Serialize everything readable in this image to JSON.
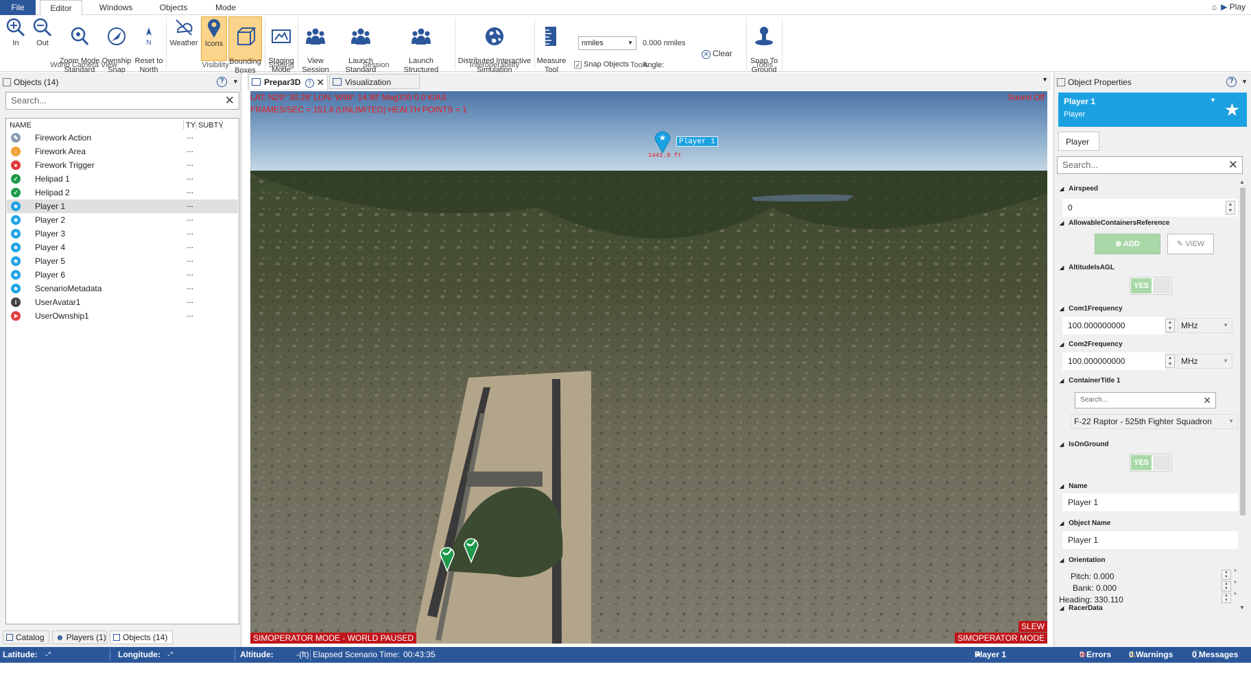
{
  "menu": {
    "items": [
      "File",
      "Editor",
      "Windows",
      "Objects",
      "Mode"
    ],
    "right_label": "Play"
  },
  "ribbon": {
    "buttons": [
      {
        "label": "In",
        "icon": "zoom-in-icon"
      },
      {
        "label": "Out",
        "icon": "zoom-out-icon"
      },
      {
        "label": "Zoom Mode\nStandard",
        "icon": "zoom-mode-icon"
      },
      {
        "label": "Ownship\nSnap",
        "icon": "ownship-snap-icon"
      },
      {
        "label": "Reset to\nNorth",
        "icon": "north-arrow-icon"
      },
      {
        "label": "Weather",
        "icon": "weather-icon"
      },
      {
        "label": "Icons",
        "icon": "map-pin-icon"
      },
      {
        "label": "Bounding\nBoxes",
        "icon": "bounding-box-icon"
      },
      {
        "label": "Staging\nMode",
        "icon": "staging-icon"
      },
      {
        "label": "View\nSession",
        "icon": "group-icon"
      },
      {
        "label": "Launch Standard\nScenario",
        "icon": "group-icon"
      },
      {
        "label": "Launch Structured\nScenario",
        "icon": "group-icon"
      },
      {
        "label": "Distributed Interactive\nSimulation",
        "icon": "globe-icon"
      },
      {
        "label": "Measure\nTool",
        "icon": "ruler-icon"
      },
      {
        "label": "Snap To\nGround",
        "icon": "snap-ground-icon"
      }
    ],
    "groups": [
      "World Camera View",
      "Visibility",
      "Staging",
      "Session",
      "Interoperability",
      "Tools",
      "Tools"
    ],
    "unit_select": "nmiles",
    "distance": "0.000 nmiles",
    "snap_objects": "Snap Objects",
    "angle": "Angle:",
    "clear": "Clear",
    "colors": {
      "selected": "#fbd38a",
      "accent": "#2b579a"
    }
  },
  "objects_panel": {
    "title": "Objects (14)",
    "search_placeholder": "Search...",
    "columns": [
      "NAME",
      "TY",
      "SUBTY"
    ],
    "rows": [
      {
        "name": "Firework Action",
        "type": "...",
        "icon": "wrench-icon",
        "color": "#8a9bb0"
      },
      {
        "name": "Firework Area",
        "type": "...",
        "icon": "area-icon",
        "color": "#f0a030"
      },
      {
        "name": "Firework Trigger",
        "type": "...",
        "icon": "trigger-icon",
        "color": "#e03c3c"
      },
      {
        "name": "Helipad 1",
        "type": "...",
        "icon": "helipad-icon",
        "color": "#1e9a4a"
      },
      {
        "name": "Helipad 2",
        "type": "...",
        "icon": "helipad-icon",
        "color": "#1e9a4a"
      },
      {
        "name": "Player 1",
        "type": "...",
        "icon": "player-icon",
        "color": "#1ba1e2"
      },
      {
        "name": "Player 2",
        "type": "...",
        "icon": "player-icon",
        "color": "#1ba1e2"
      },
      {
        "name": "Player 3",
        "type": "...",
        "icon": "player-icon",
        "color": "#1ba1e2"
      },
      {
        "name": "Player 4",
        "type": "...",
        "icon": "player-icon",
        "color": "#1ba1e2"
      },
      {
        "name": "Player 5",
        "type": "...",
        "icon": "player-icon",
        "color": "#1ba1e2"
      },
      {
        "name": "Player 6",
        "type": "...",
        "icon": "player-icon",
        "color": "#1ba1e2"
      },
      {
        "name": "ScenarioMetadata",
        "type": "...",
        "icon": "player-icon",
        "color": "#1ba1e2"
      },
      {
        "name": "UserAvatar1",
        "type": "...",
        "icon": "avatar-icon",
        "color": "#444444"
      },
      {
        "name": "UserOwnship1",
        "type": "...",
        "icon": "ownship-icon",
        "color": "#e03c3c"
      }
    ],
    "tabs": [
      "Catalog",
      "Players (1)",
      "Objects (14)"
    ]
  },
  "doc_tabs": [
    "Prepar3D",
    "Visualization"
  ],
  "viewport": {
    "hud_line1": "LAT: N29° 30.28'  LON: W98° 14.90'    Mag330  0.0 KIAS",
    "hud_line2": "FRAMES/SEC = 151.6   (UNLIMITED)   HEALTH POINTS = 1",
    "sound": "Sound Off",
    "marker_label": "Player 1",
    "marker_distance": "1441.8 ft",
    "mode_left": "SIMOPERATOR MODE - WORLD PAUSED",
    "mode_right_1": "SLEW",
    "mode_right_2": "SIMOPERATOR MODE"
  },
  "properties_panel": {
    "title": "Object Properties",
    "object_name": "Player 1",
    "object_type": "Player",
    "breadcrumb": "Player",
    "search_placeholder": "Search...",
    "airspeed_label": "Airspeed",
    "airspeed_value": "0",
    "allowable_label": "AllowableContainersReference",
    "add_label": "ADD",
    "view_label": "VIEW",
    "altitude_agl_label": "AltitudeIsAGL",
    "yes": "YES",
    "com1_label": "Com1Frequency",
    "com1_value": "100.000000000",
    "com2_label": "Com2Frequency",
    "com2_value": "100.000000000",
    "unit": "MHz",
    "container_label": "ContainerTitle 1",
    "container_search": "Search...",
    "container_value": "F-22 Raptor - 525th Fighter Squadron",
    "on_ground_label": "IsOnGround",
    "name_label": "Name",
    "name_value": "Player 1",
    "objname_label": "Object Name",
    "objname_value": "Player 1",
    "orientation_label": "Orientation",
    "pitch": "Pitch:  0.000",
    "bank": "Bank:  0.000",
    "heading": "Heading:  330.110",
    "degree": "°",
    "racer_label": "RacerData"
  },
  "status": {
    "latitude": "Latitude:",
    "lat_val": "-°",
    "longitude": "Longitude:",
    "lon_val": "-°",
    "altitude": "Altitude:",
    "alt_val": "-(ft)",
    "elapsed": "Elapsed Scenario Time:",
    "elapsed_val": "00:43:35",
    "player": "Player 1",
    "errors": "0 Errors",
    "warnings": "0 Warnings",
    "messages": "0 Messages"
  }
}
